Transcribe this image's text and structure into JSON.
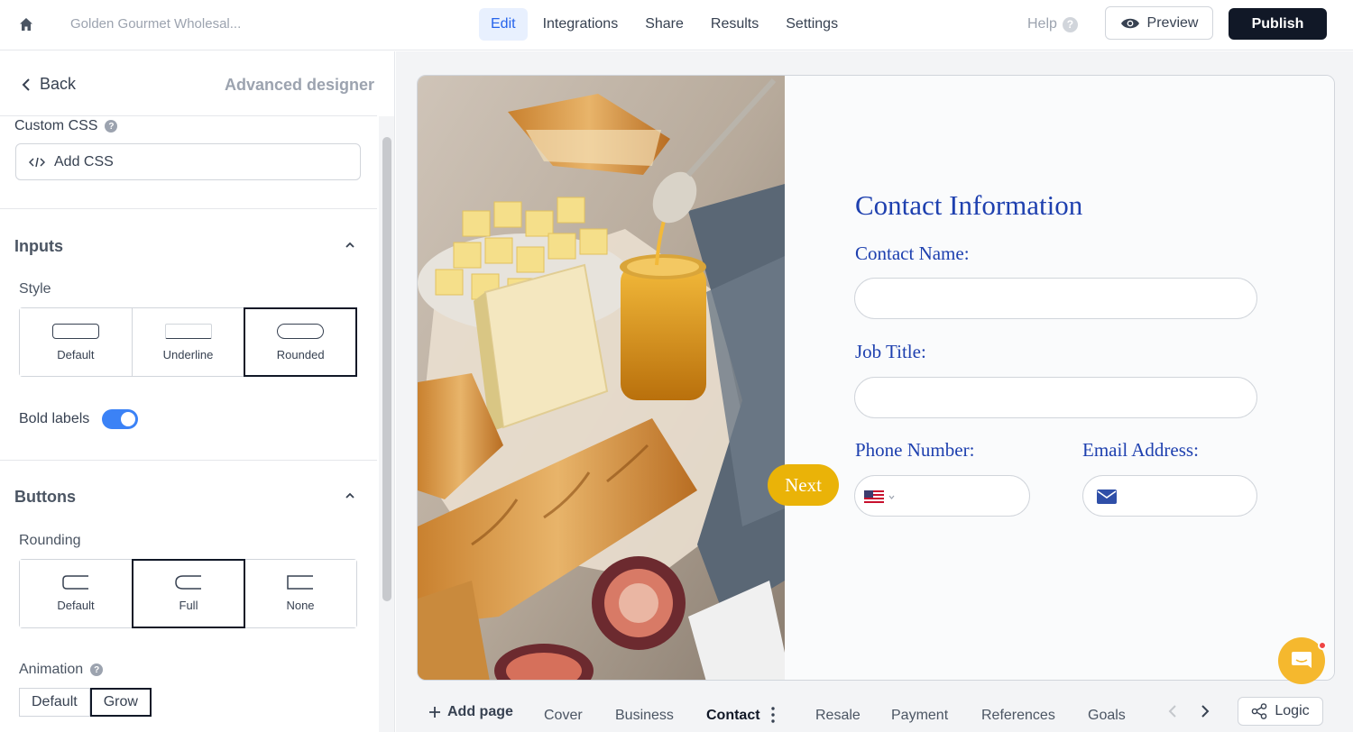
{
  "header": {
    "project_title": "Golden Gourmet Wholesal...",
    "tabs": [
      {
        "label": "Edit",
        "active": true
      },
      {
        "label": "Integrations",
        "active": false
      },
      {
        "label": "Share",
        "active": false
      },
      {
        "label": "Results",
        "active": false
      },
      {
        "label": "Settings",
        "active": false
      }
    ],
    "help_label": "Help",
    "preview_label": "Preview",
    "publish_label": "Publish"
  },
  "panel": {
    "back_label": "Back",
    "title": "Advanced designer",
    "custom_css": {
      "label": "Custom CSS",
      "button_label": "Add CSS"
    },
    "inputs": {
      "title": "Inputs",
      "style_label": "Style",
      "style_options": [
        "Default",
        "Underline",
        "Rounded"
      ],
      "selected_style": "Rounded",
      "bold_labels_label": "Bold labels",
      "bold_labels_on": true
    },
    "buttons": {
      "title": "Buttons",
      "rounding_label": "Rounding",
      "rounding_options": [
        "Default",
        "Full",
        "None"
      ],
      "selected_rounding": "Full",
      "animation_label": "Animation",
      "animation_options": [
        "Default",
        "Grow"
      ],
      "selected_animation": "Grow"
    }
  },
  "form": {
    "title": "Contact Information",
    "contact_name_label": "Contact Name:",
    "job_title_label": "Job Title:",
    "phone_label": "Phone Number:",
    "email_label": "Email Address:",
    "next_label": "Next",
    "colors": {
      "label": "#1e40af",
      "button": "#eab308"
    }
  },
  "pages": {
    "add_label": "Add page",
    "tabs": [
      "Cover",
      "Business",
      "Contact",
      "Resale",
      "Payment",
      "References",
      "Goals"
    ],
    "active": "Contact",
    "logic_label": "Logic"
  }
}
